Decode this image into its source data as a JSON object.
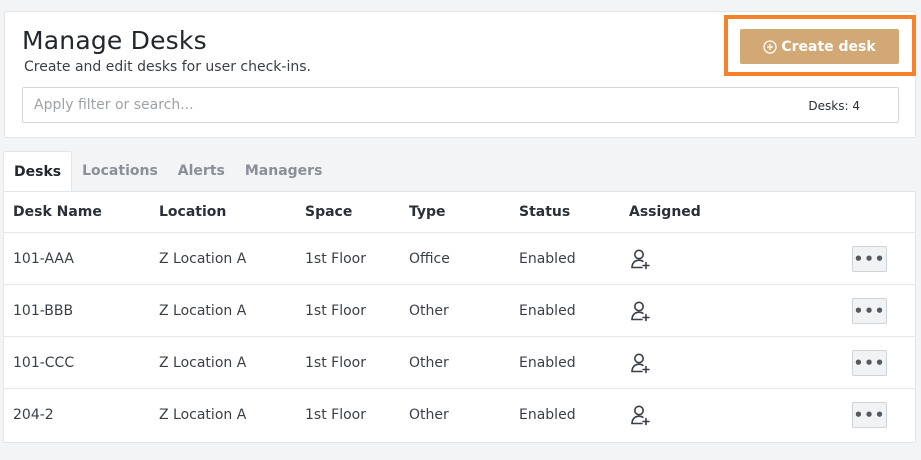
{
  "header": {
    "title": "Manage Desks",
    "subtitle": "Create and edit desks for user check-ins.",
    "create_button_label": "Create desk",
    "create_button_icon": "plus-circle-icon",
    "highlight_color": "#f5822a",
    "accent_color": "#d2a875"
  },
  "search": {
    "placeholder": "Apply filter or search...",
    "value": "",
    "count_label": "Desks: 4"
  },
  "tabs": [
    {
      "label": "Desks",
      "active": true
    },
    {
      "label": "Locations",
      "active": false
    },
    {
      "label": "Alerts",
      "active": false
    },
    {
      "label": "Managers",
      "active": false
    }
  ],
  "table": {
    "columns": [
      "Desk Name",
      "Location",
      "Space",
      "Type",
      "Status",
      "Assigned"
    ],
    "rows": [
      {
        "name": "101-AAA",
        "location": "Z Location A",
        "space": "1st Floor",
        "type": "Office",
        "status": "Enabled",
        "assigned_icon": "assign-user-icon",
        "actions": "•••"
      },
      {
        "name": "101-BBB",
        "location": "Z Location A",
        "space": "1st Floor",
        "type": "Other",
        "status": "Enabled",
        "assigned_icon": "assign-user-icon",
        "actions": "•••"
      },
      {
        "name": "101-CCC",
        "location": "Z Location A",
        "space": "1st Floor",
        "type": "Other",
        "status": "Enabled",
        "assigned_icon": "assign-user-icon",
        "actions": "•••"
      },
      {
        "name": "204-2",
        "location": "Z Location A",
        "space": "1st Floor",
        "type": "Other",
        "status": "Enabled",
        "assigned_icon": "assign-user-icon",
        "actions": "•••"
      }
    ]
  }
}
